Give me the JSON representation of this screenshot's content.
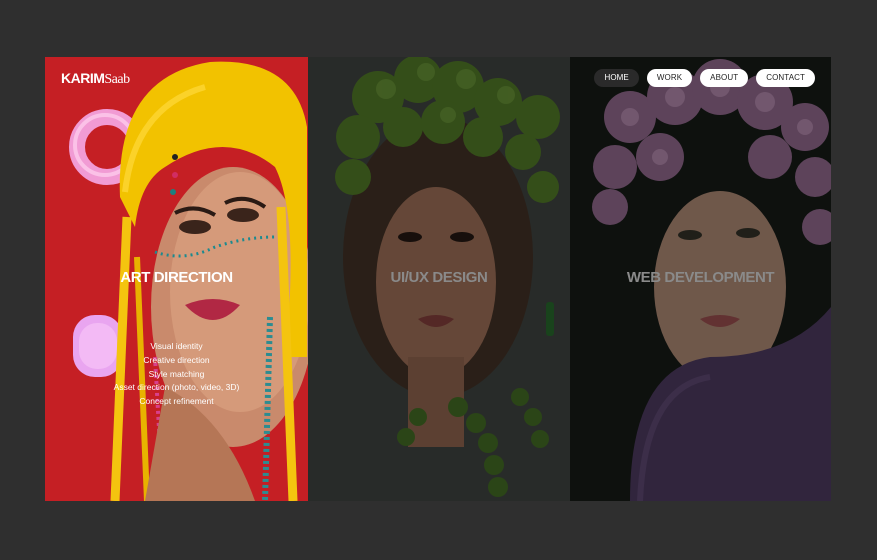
{
  "logo": {
    "first": "KARIM",
    "last": "Saab"
  },
  "nav": [
    {
      "label": "HOME",
      "active": true
    },
    {
      "label": "WORK",
      "active": false
    },
    {
      "label": "ABOUT",
      "active": false
    },
    {
      "label": "CONTACT",
      "active": false
    }
  ],
  "panels": [
    {
      "title": "ART DIRECTION",
      "services": [
        "Visual identity",
        "Creative direction",
        "Style matching",
        "Asset direction (photo, video, 3D)",
        "Concept refinement"
      ]
    },
    {
      "title": "UI/UX DESIGN"
    },
    {
      "title": "WEB DEVELOPMENT"
    }
  ],
  "colors": {
    "background": "#2f2f2f",
    "art_direction_panel": "#c51f24",
    "headwrap": "#f2c200",
    "green_headpiece": "#5f8f2e",
    "purple_headpiece": "#a97aa4"
  }
}
